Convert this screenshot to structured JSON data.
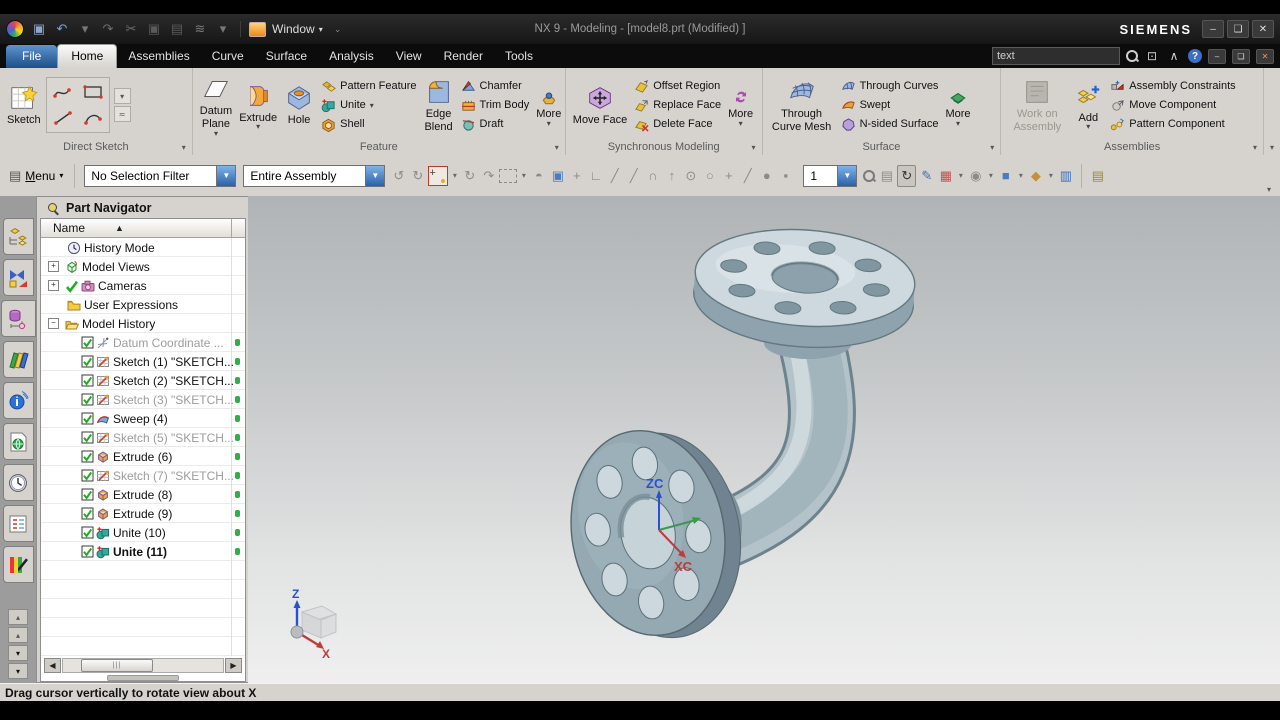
{
  "window": {
    "title": "NX 9 - Modeling - [model8.prt (Modified) ]",
    "brand": "SIEMENS",
    "window_label": "Window",
    "search_value": "text",
    "qa_icons": [
      {
        "name": "save-icon",
        "glyph": "▣",
        "color": "#8fa6c8"
      },
      {
        "name": "undo-icon",
        "glyph": "↶",
        "color": "#6fa8dc"
      },
      {
        "name": "undo-dropdown",
        "glyph": "▾",
        "color": "#777777"
      },
      {
        "name": "redo-icon",
        "glyph": "↷",
        "color": "#6d6d6d"
      },
      {
        "name": "cut-icon",
        "glyph": "✂",
        "color": "#6d6d6d"
      },
      {
        "name": "copy-icon",
        "glyph": "▣",
        "color": "#5a5a5a"
      },
      {
        "name": "paste-icon",
        "glyph": "▤",
        "color": "#5a5a5a"
      },
      {
        "name": "view-tool-icon",
        "glyph": "≋",
        "color": "#7a7a7a"
      },
      {
        "name": "view-tool-dropdown",
        "glyph": "▾",
        "color": "#777777"
      }
    ]
  },
  "menubar": {
    "tabs": [
      {
        "label": "File",
        "style": "file"
      },
      {
        "label": "Home",
        "style": "active"
      },
      {
        "label": "Assemblies",
        "style": ""
      },
      {
        "label": "Curve",
        "style": ""
      },
      {
        "label": "Surface",
        "style": ""
      },
      {
        "label": "Analysis",
        "style": ""
      },
      {
        "label": "View",
        "style": ""
      },
      {
        "label": "Render",
        "style": ""
      },
      {
        "label": "Tools",
        "style": ""
      }
    ]
  },
  "ribbon": {
    "direct_sketch": {
      "label": "Direct Sketch",
      "sketch": "Sketch"
    },
    "feature": {
      "label": "Feature",
      "datum_plane": "Datum Plane",
      "extrude": "Extrude",
      "hole": "Hole",
      "pattern_feature": "Pattern Feature",
      "unite": "Unite",
      "shell": "Shell",
      "edge_blend": "Edge Blend",
      "chamfer": "Chamfer",
      "trim_body": "Trim Body",
      "draft": "Draft",
      "more": "More"
    },
    "sync": {
      "label": "Synchronous Modeling",
      "move_face": "Move Face",
      "offset_region": "Offset Region",
      "replace_face": "Replace Face",
      "delete_face": "Delete Face",
      "more": "More"
    },
    "surface": {
      "label": "Surface",
      "through_curve_mesh": "Through Curve Mesh",
      "through_curves": "Through Curves",
      "swept": "Swept",
      "n_sided_surface": "N-sided Surface",
      "more": "More"
    },
    "assemblies": {
      "label": "Assemblies",
      "work_on_assembly": "Work on Assembly",
      "add": "Add",
      "assembly_constraints": "Assembly Constraints",
      "move_component": "Move Component",
      "pattern_component": "Pattern Component"
    }
  },
  "selection_bar": {
    "menu_label": "Menu",
    "filter_value": "No Selection Filter",
    "scope_value": "Entire Assembly",
    "layer_value": "1",
    "icons_left": [
      {
        "name": "gesture-pan-icon",
        "glyph": "↺"
      },
      {
        "name": "gesture-rotate-icon",
        "glyph": "↻"
      },
      {
        "name": "snap-point-toggle",
        "special": "snap"
      },
      {
        "name": "snap-dropdown",
        "glyph": "▾",
        "dd": true
      },
      {
        "name": "rotate-point-icon",
        "glyph": "↻"
      },
      {
        "name": "rotate-curve-icon",
        "glyph": "↷"
      },
      {
        "name": "marquee-select-icon",
        "special": "marquee"
      },
      {
        "name": "marquee-dropdown",
        "glyph": "▾",
        "dd": true
      },
      {
        "name": "shaded-object-icon",
        "glyph": "◓"
      },
      {
        "name": "work-section-icon",
        "glyph": "▣",
        "color": "#4a7dc0"
      },
      {
        "name": "move-object-icon",
        "glyph": "+"
      },
      {
        "name": "csys-icon",
        "glyph": "∟"
      },
      {
        "name": "endpoint-snap-icon",
        "glyph": "╱"
      },
      {
        "name": "midpoint-snap-icon",
        "glyph": "╱"
      },
      {
        "name": "curve-snap-icon",
        "glyph": "∩"
      },
      {
        "name": "point-on-curve-snap-icon",
        "glyph": "↑"
      },
      {
        "name": "arc-center-snap-icon",
        "glyph": "⊙"
      },
      {
        "name": "circle-snap-icon",
        "glyph": "○"
      },
      {
        "name": "point-snap-icon",
        "glyph": "+"
      },
      {
        "name": "tangent-snap-icon",
        "glyph": "╱"
      },
      {
        "name": "sphere-icon",
        "glyph": "●"
      },
      {
        "name": "box-icon",
        "glyph": "▪"
      }
    ],
    "icons_right": [
      {
        "name": "zoom-window-icon",
        "special": "lens"
      },
      {
        "name": "fit-view-icon",
        "glyph": "▤"
      },
      {
        "name": "rotate-view-icon",
        "glyph": "↻",
        "active": true,
        "color": "#333333"
      },
      {
        "name": "pen-icon",
        "glyph": "✎",
        "color": "#3a6fbf"
      },
      {
        "name": "perspective-icon",
        "glyph": "▦",
        "color": "#c0504d"
      },
      {
        "name": "perspective-dropdown",
        "glyph": "▾",
        "dd": true
      },
      {
        "name": "rendering-style-icon",
        "glyph": "◉"
      },
      {
        "name": "rendering-style-dropdown",
        "glyph": "▾",
        "dd": true
      },
      {
        "name": "shaded-view-icon",
        "glyph": "■",
        "color": "#4a7dc0"
      },
      {
        "name": "shaded-view-dropdown",
        "glyph": "▾",
        "dd": true
      },
      {
        "name": "orient-view-icon",
        "glyph": "◆",
        "color": "#c4913a"
      },
      {
        "name": "orient-view-dropdown",
        "glyph": "▾",
        "dd": true
      },
      {
        "name": "window-stack-icon",
        "glyph": "▥",
        "color": "#3a6fbf"
      }
    ],
    "level_icon_name": "level-icon",
    "overflow_glyph": "▾"
  },
  "resource_bar": {
    "tabs": [
      {
        "name": "assembly-navigator-tab",
        "sym": "res-assy"
      },
      {
        "name": "constraint-navigator-tab",
        "sym": "res-constraint"
      },
      {
        "name": "part-navigator-tab",
        "sym": "res-part",
        "active": true
      },
      {
        "name": "reuse-library-tab",
        "sym": "res-reuse"
      },
      {
        "name": "hd3d-tools-tab",
        "sym": "res-hd3d"
      },
      {
        "name": "web-browser-tab",
        "sym": "res-web"
      },
      {
        "name": "history-tab",
        "sym": "res-history"
      },
      {
        "name": "process-studio-tab",
        "sym": "res-process"
      },
      {
        "name": "roles-tab",
        "sym": "res-roles"
      }
    ]
  },
  "navigator": {
    "title": "Part Navigator",
    "name_column": "Name",
    "rows": [
      {
        "label": "History Mode",
        "icon": "clock",
        "lvl": 1
      },
      {
        "label": "Model Views",
        "icon": "modelviews",
        "expand": "+",
        "lvl": 0
      },
      {
        "label": "Cameras",
        "icon": "camera",
        "expand": "+",
        "pre": "check",
        "lvl": 0
      },
      {
        "label": "User Expressions",
        "icon": "folder",
        "lvl": 1
      },
      {
        "label": "Model History",
        "icon": "folder-open",
        "expand": "−",
        "lvl": 0
      },
      {
        "label": "Datum Coordinate ...",
        "icon": "datum",
        "checkbox": true,
        "gray": true,
        "lvl": 2,
        "status": true
      },
      {
        "label": "Sketch (1) \"SKETCH...",
        "icon": "sketch",
        "checkbox": true,
        "lvl": 2,
        "status": true
      },
      {
        "label": "Sketch (2) \"SKETCH...",
        "icon": "sketch",
        "checkbox": true,
        "lvl": 2,
        "status": true
      },
      {
        "label": "Sketch (3) \"SKETCH...",
        "icon": "sketch",
        "checkbox": true,
        "gray": true,
        "lvl": 2,
        "status": true
      },
      {
        "label": "Sweep (4)",
        "icon": "sweep",
        "checkbox": true,
        "lvl": 2,
        "status": true
      },
      {
        "label": "Sketch (5) \"SKETCH...",
        "icon": "sketch",
        "checkbox": true,
        "gray": true,
        "lvl": 2,
        "status": true
      },
      {
        "label": "Extrude (6)",
        "icon": "extrude",
        "checkbox": true,
        "lvl": 2,
        "status": true
      },
      {
        "label": "Sketch (7) \"SKETCH...",
        "icon": "sketch",
        "checkbox": true,
        "gray": true,
        "lvl": 2,
        "status": true
      },
      {
        "label": "Extrude (8)",
        "icon": "extrude",
        "checkbox": true,
        "lvl": 2,
        "status": true
      },
      {
        "label": "Extrude (9)",
        "icon": "extrude",
        "checkbox": true,
        "lvl": 2,
        "status": true
      },
      {
        "label": "Unite (10)",
        "icon": "unite",
        "checkbox": true,
        "lvl": 2,
        "status": true
      },
      {
        "label": "Unite (11)",
        "icon": "unite",
        "checkbox": true,
        "bold": true,
        "lvl": 2,
        "status": true
      }
    ]
  },
  "viewport": {
    "wcs_z": "ZC",
    "wcs_x": "XC",
    "triad_z": "Z",
    "triad_x": "X",
    "model_face_color": "#cdd9df",
    "model_rim_color": "#8ea3ad",
    "flange_front_color": "#95a9b3"
  },
  "statusbar": {
    "message": "Drag cursor vertically to rotate view about X"
  }
}
